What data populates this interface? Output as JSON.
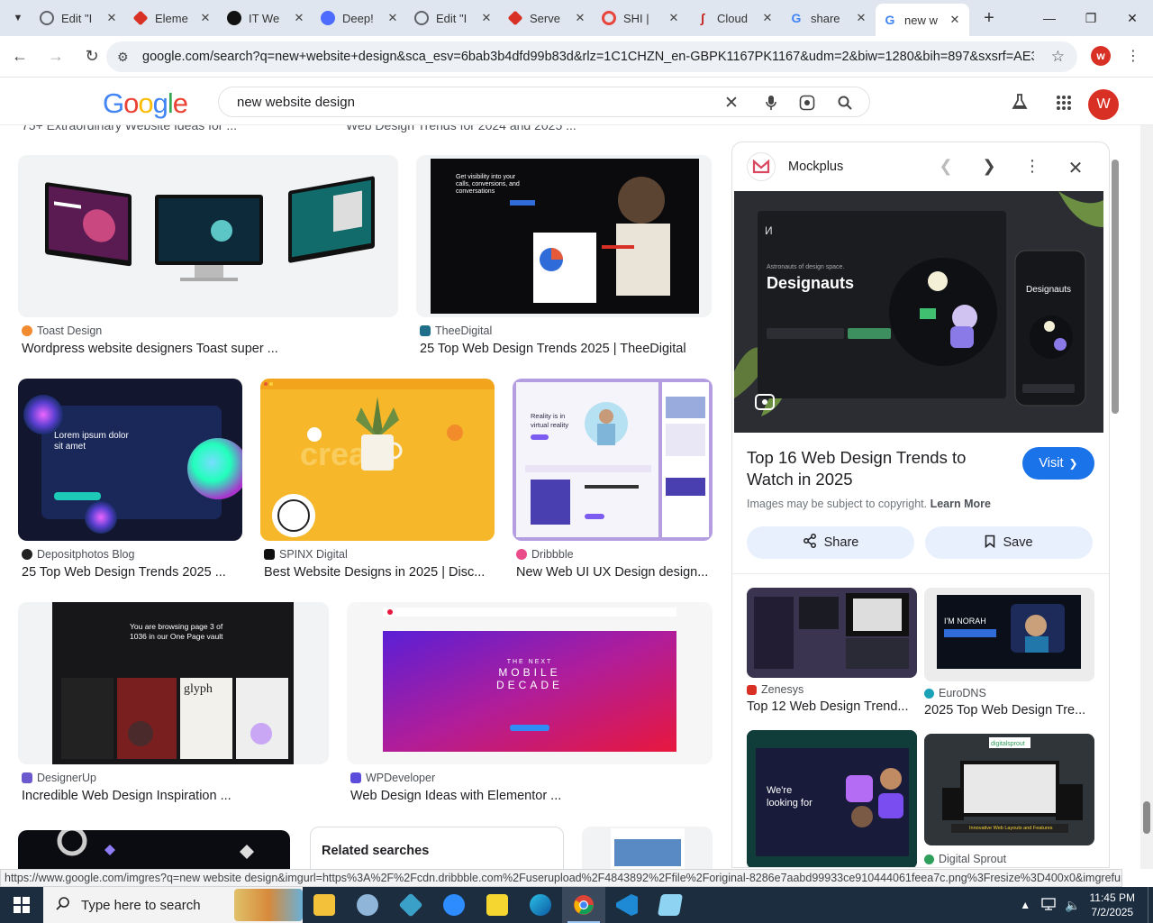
{
  "browser": {
    "tabs": [
      {
        "label": "Edit \"I",
        "icon": "globe-icon",
        "color": "#5f6368"
      },
      {
        "label": "Eleme",
        "icon": "ruby-icon",
        "color": "#d93025"
      },
      {
        "label": "IT We",
        "icon": "openai-icon",
        "color": "#111111"
      },
      {
        "label": "Deep!",
        "icon": "deepseek-icon",
        "color": "#4d6bfe"
      },
      {
        "label": "Edit \"I",
        "icon": "globe-icon",
        "color": "#5f6368"
      },
      {
        "label": "Serve",
        "icon": "ruby-icon",
        "color": "#d93025"
      },
      {
        "label": "SHI |",
        "icon": "ring-icon",
        "color": "#e8453c"
      },
      {
        "label": "Cloud",
        "icon": "cloud-icon",
        "color": "#c5221f"
      },
      {
        "label": "share",
        "icon": "google-icon",
        "color": "#4285f4"
      },
      {
        "label": "new w",
        "icon": "google-icon",
        "color": "#4285f4",
        "active": true
      }
    ],
    "url": "google.com/search?q=new+website+design&sca_esv=6bab3b4dfd99b83d&rlz=1C1CHZN_en-GBPK1167PK1167&udm=2&biw=1280&bih=897&sxsrf=AE3Tif...",
    "profile_initial": "w"
  },
  "google": {
    "logo": "Google",
    "query": "new website design",
    "avatar_initial": "W"
  },
  "partial_titles": [
    "75+ Extraordinary Website Ideas for ...",
    "Web Design Trends for 2024 and 2025 ..."
  ],
  "results": [
    {
      "source": "Toast Design",
      "title": "Wordpress website designers Toast super ...",
      "icon_color": "#f28b30"
    },
    {
      "source": "TheeDigital",
      "title": "25 Top Web Design Trends 2025 | TheeDigital",
      "icon_color": "#1f6f8b"
    },
    {
      "source": "Depositphotos Blog",
      "title": "25 Top Web Design Trends 2025 ...",
      "icon_color": "#222222"
    },
    {
      "source": "SPINX Digital",
      "title": "Best Website Designs in 2025 | Disc...",
      "icon_color": "#111111"
    },
    {
      "source": "Dribbble",
      "title": "New Web UI UX Design design...",
      "icon_color": "#ea4c89"
    },
    {
      "source": "DesignerUp",
      "title": "Incredible Web Design Inspiration ...",
      "icon_color": "#6a5acd"
    },
    {
      "source": "WPDeveloper",
      "title": "Web Design Ideas with Elementor ...",
      "icon_color": "#5b4cdb"
    }
  ],
  "thumb_text": {
    "theedigital": "Get visibility into your calls, conversions, and conversations",
    "depositphotos": "Lorem ipsum dolor sit amet",
    "dribbble": "Reality is in virtual reality",
    "designerup": "You are browsing page 3 of 1036 in our One Page vault",
    "glyph": "glyph",
    "elementor": "THE NEXT MOBILE DECADE"
  },
  "related": {
    "heading": "Related searches"
  },
  "preview": {
    "site": "Mockplus",
    "title": "Top 16 Web Design Trends to Watch in 2025",
    "visit_label": "Visit",
    "copyright_text": "Images may be subject to copyright.",
    "learn_more": "Learn More",
    "share_label": "Share",
    "save_label": "Save",
    "image_text": {
      "headline": "Designauts",
      "sub": "Astronauts of design space."
    },
    "related": [
      {
        "source": "Zenesys",
        "title": "Top 12 Web Design Trend...",
        "icon_color": "#d93025"
      },
      {
        "source": "EuroDNS",
        "title": "2025 Top Web Design Tre...",
        "icon_color": "#1aa3b8"
      },
      {
        "source": "",
        "title": "",
        "icon_color": ""
      },
      {
        "source": "Digital Sprout",
        "title": "",
        "icon_color": "#2e9e5b"
      }
    ],
    "related_thumb_text": {
      "looking": "We're looking for",
      "sprout": "digitalsprout",
      "sprout_caption": "Innovative Web Layouts and Features"
    }
  },
  "status_url": "https://www.google.com/imgres?q=new website design&imgurl=https%3A%2F%2Fcdn.dribbble.com%2Fuserupload%2F4843892%2Ffile%2Foriginal-8286e7aabd99933ce910444061feea7c.png%3Fresize%3D400x0&imgrefurl=https%...",
  "taskbar": {
    "search_placeholder": "Type here to search",
    "time": "11:45 PM",
    "date": "7/2/2025"
  }
}
